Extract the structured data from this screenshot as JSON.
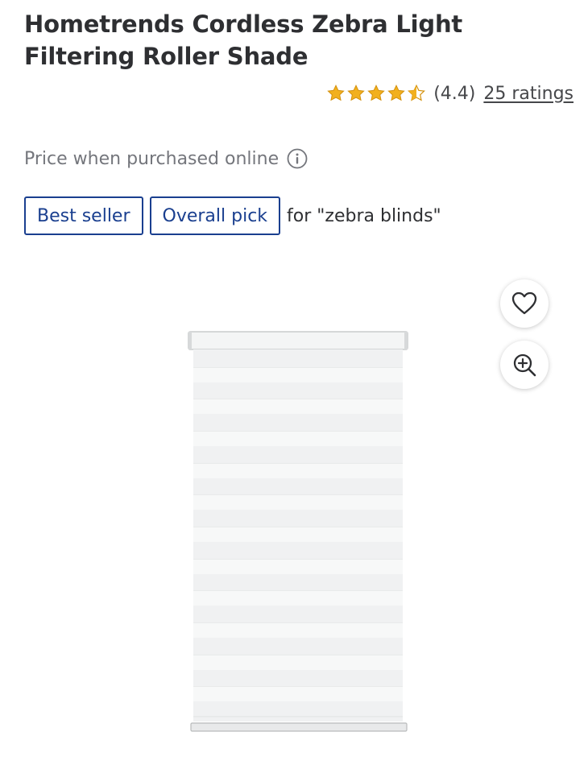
{
  "product": {
    "title": "Hometrends Cordless Zebra Light Filtering Roller Shade",
    "rating": 4.4,
    "rating_display": "(4.4)",
    "ratings_count_label": "25 ratings",
    "price_note": "Price when purchased online",
    "badges": [
      {
        "label": "Best seller"
      },
      {
        "label": "Overall pick"
      }
    ],
    "badge_context": "for \"zebra blinds\""
  },
  "icons": {
    "stars": "star-icon",
    "price_info": "info-icon",
    "favorite": "heart-icon",
    "zoom": "zoom-in-icon"
  },
  "colors": {
    "star": "#f2b01e",
    "badge_border": "#1a3f8f",
    "title_text": "#2e2f32",
    "muted_text": "#74767c"
  }
}
